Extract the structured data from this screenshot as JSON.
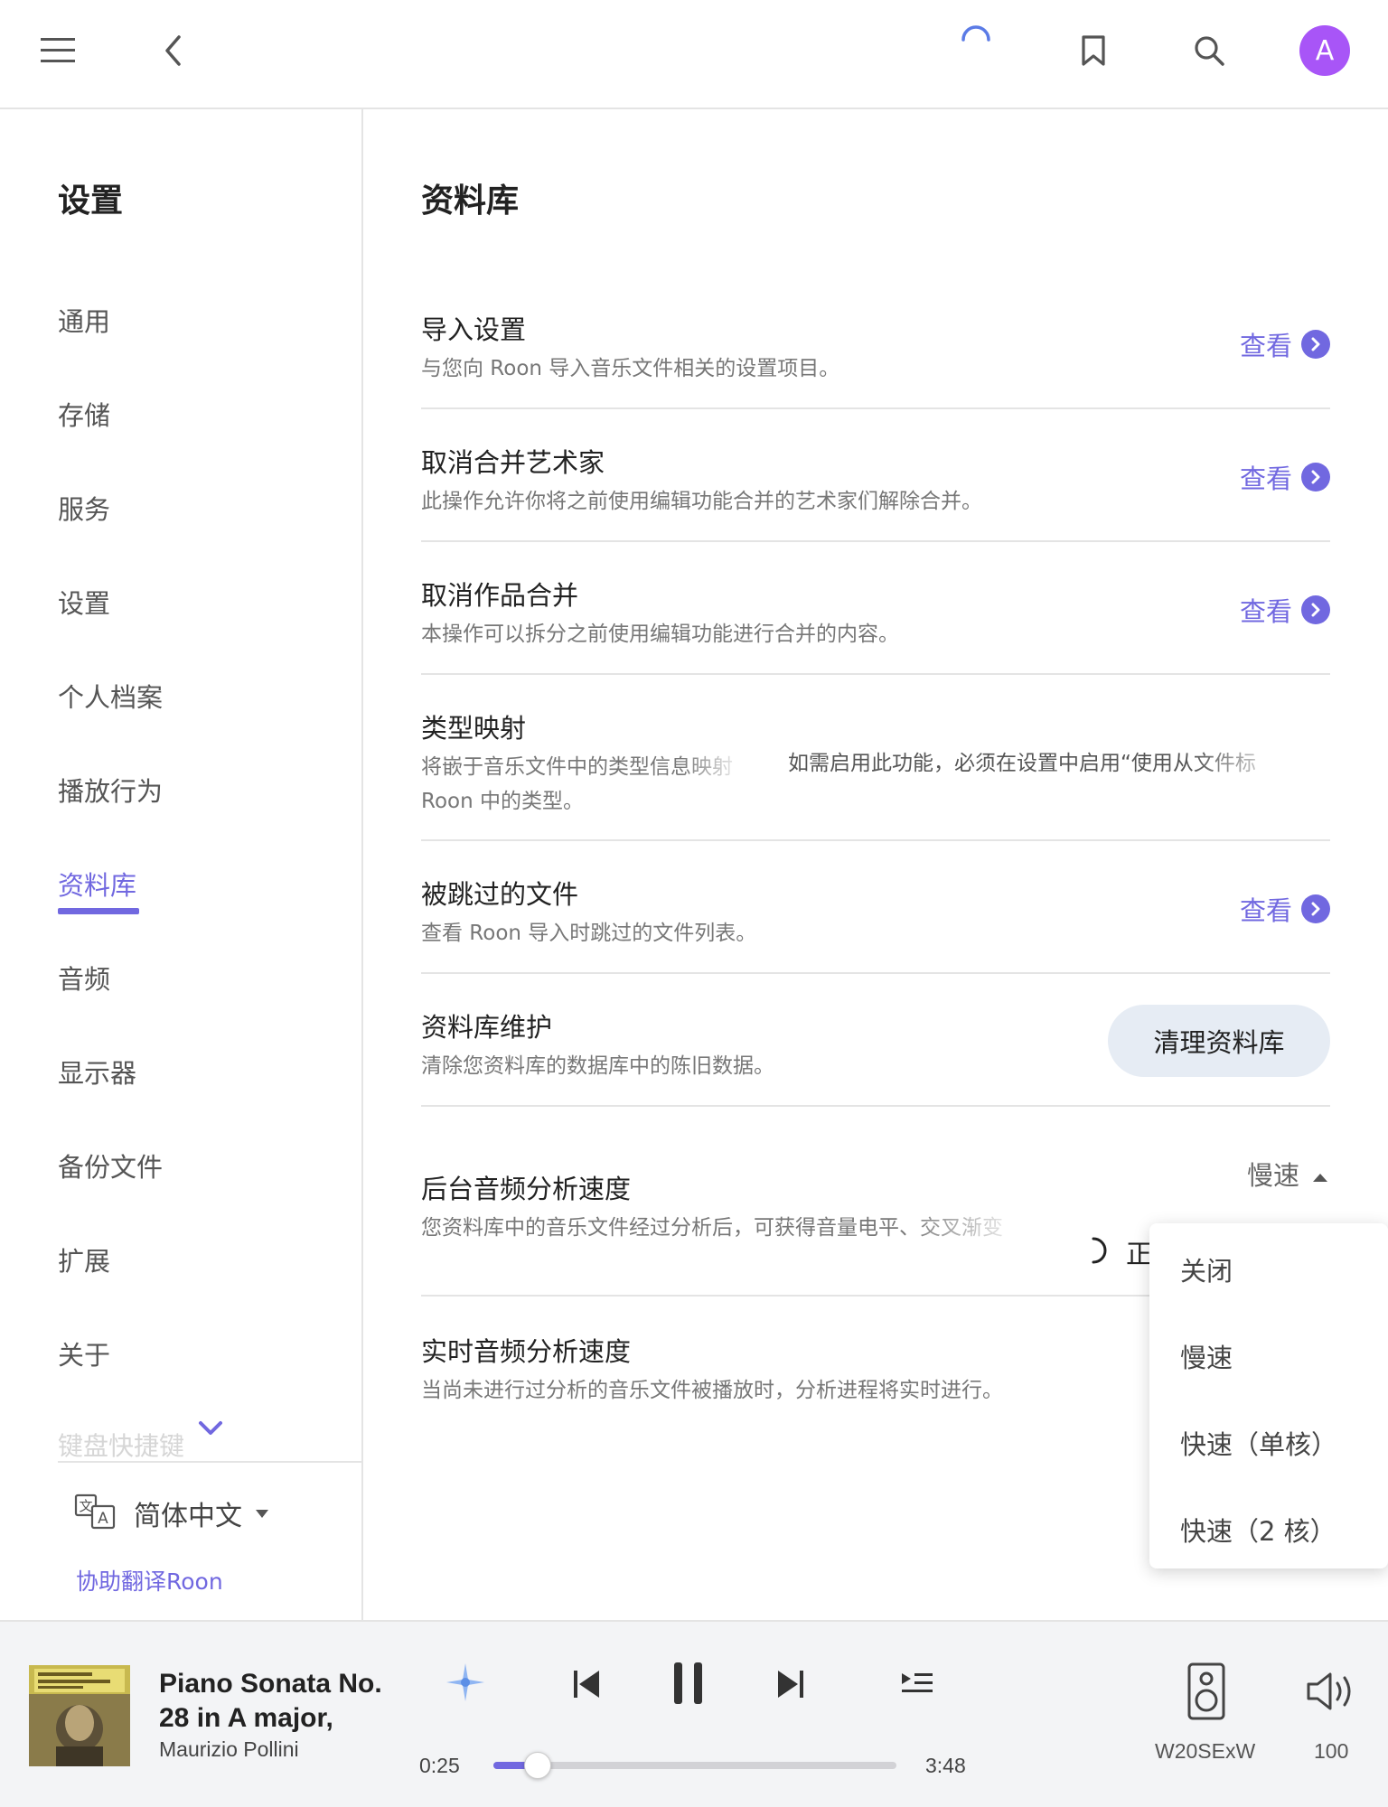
{
  "topbar": {
    "menu_icon": "hamburger-menu-icon",
    "back_icon": "chevron-left-icon",
    "loading_icon": "spinner-icon",
    "bookmark_icon": "bookmark-icon",
    "search_icon": "search-icon",
    "avatar_letter": "A",
    "avatar_color": "#a855f7"
  },
  "sidebar": {
    "title": "设置",
    "items": [
      {
        "label": "通用"
      },
      {
        "label": "存储"
      },
      {
        "label": "服务"
      },
      {
        "label": "设置"
      },
      {
        "label": "个人档案"
      },
      {
        "label": "播放行为"
      },
      {
        "label": "资料库",
        "active": true
      },
      {
        "label": "音频"
      },
      {
        "label": "显示器"
      },
      {
        "label": "备份文件"
      },
      {
        "label": "扩展"
      },
      {
        "label": "关于"
      }
    ],
    "faded_item": "键盘快捷键",
    "language": "简体中文",
    "help_translate": "协助翻译Roon"
  },
  "main": {
    "title": "资料库",
    "view_label": "查看",
    "rows": [
      {
        "title": "导入设置",
        "desc": "与您向 Roon 导入音乐文件相关的设置项目。"
      },
      {
        "title": "取消合并艺术家",
        "desc": "此操作允许你将之前使用编辑功能合并的艺术家们解除合并。"
      },
      {
        "title": "取消作品合并",
        "desc": "本操作可以拆分之前使用编辑功能进行合并的内容。"
      },
      {
        "title": "类型映射",
        "desc1": "将嵌于音乐文件中的类型信息映射",
        "desc2": "Roon 中的类型。",
        "note": "如需启用此功能，必须在设置中启用“使用从文件标"
      },
      {
        "title": "被跳过的文件",
        "desc": "查看 Roon 导入时跳过的文件列表。"
      },
      {
        "title": "资料库维护",
        "desc": "清除您资料库的数据库中的陈旧数据。",
        "button": "清理资料库"
      },
      {
        "title": "后台音频分析速度",
        "desc": "您资料库中的音乐文件经过分析后，可获得音量电平、交叉渐变",
        "value": "慢速",
        "status": "正"
      },
      {
        "title": "实时音频分析速度",
        "desc": "当尚未进行过分析的音乐文件被播放时，分析进程将实时进行。"
      }
    ],
    "dropdown_options": [
      "关闭",
      "慢速",
      "快速（单核）",
      "快速（2 核）"
    ]
  },
  "player": {
    "title": "Piano Sonata No. 28 in A major,",
    "artist": "Maurizio Pollini",
    "elapsed": "0:25",
    "duration": "3:48",
    "progress": 0.11,
    "zone": "W20SExW",
    "volume": "100",
    "accent": "#7168e0"
  }
}
